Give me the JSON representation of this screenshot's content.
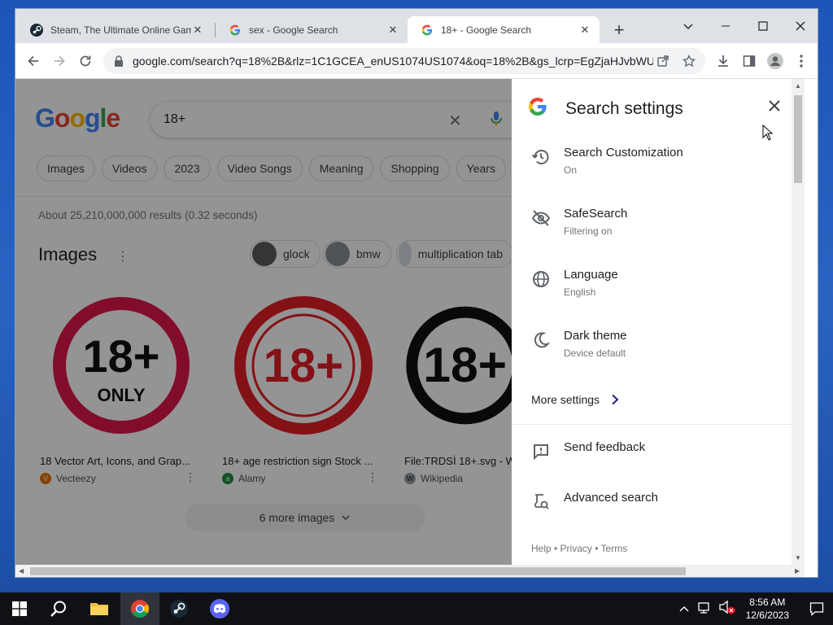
{
  "browser": {
    "tabs": [
      {
        "title": "Steam, The Ultimate Online Gam",
        "active": false
      },
      {
        "title": "sex - Google Search",
        "active": false
      },
      {
        "title": "18+ - Google Search",
        "active": true
      }
    ],
    "url": "google.com/search?q=18%2B&rlz=1C1GCEA_enUS1074US1074&oq=18%2B&gs_lcrp=EgZjaHJvbWU..."
  },
  "search": {
    "logo": "Google",
    "query": "18+",
    "chips": [
      "Images",
      "Videos",
      "2023",
      "Video Songs",
      "Meaning",
      "Shopping",
      "Years"
    ],
    "stats": "About 25,210,000,000 results (0.32 seconds)"
  },
  "images": {
    "title": "Images",
    "suggestions": [
      "glock",
      "bmw",
      "multiplication tab"
    ],
    "cards": [
      {
        "badge_main": "18+",
        "badge_sub": "ONLY",
        "caption": "18 Vector Art, Icons, and Grap...",
        "source": "Vecteezy",
        "source_color": "#e37400"
      },
      {
        "badge_main": "18+",
        "badge_sub": "",
        "caption": "18+ age restriction sign Stock ...",
        "source": "Alamy",
        "source_color": "#1e8e3e"
      },
      {
        "badge_main": "18+",
        "badge_sub": "",
        "caption": "File:TRDSİ 18+.svg - W",
        "source": "Wikipedia",
        "source_color": "#5f6368"
      }
    ],
    "more_label": "6 more images"
  },
  "panel": {
    "title": "Search settings",
    "rows": [
      {
        "label": "Search Customization",
        "sub": "On"
      },
      {
        "label": "SafeSearch",
        "sub": "Filtering on"
      },
      {
        "label": "Language",
        "sub": "English"
      },
      {
        "label": "Dark theme",
        "sub": "Device default"
      }
    ],
    "more_settings": "More settings",
    "send_feedback": "Send feedback",
    "advanced_search": "Advanced search",
    "footer": "Help • Privacy • Terms"
  },
  "taskbar": {
    "time": "8:56 AM",
    "date": "12/6/2023"
  }
}
